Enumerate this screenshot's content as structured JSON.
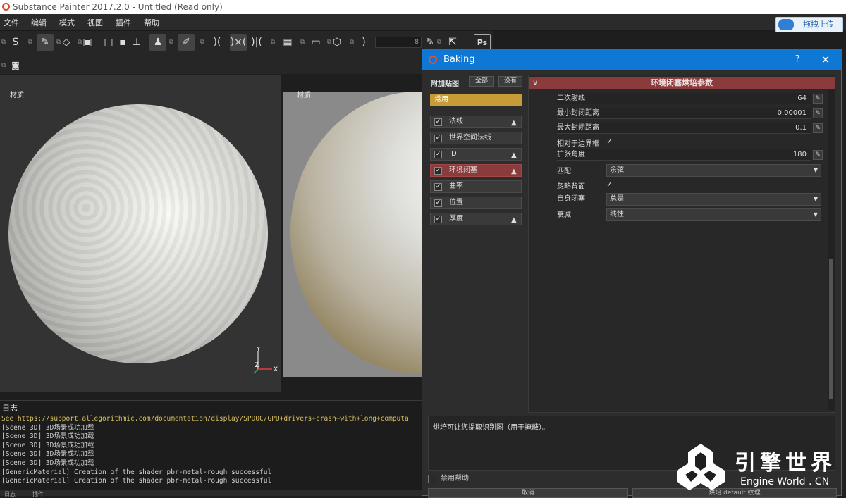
{
  "window": {
    "title": "Substance Painter 2017.2.0 - Untitled (Read only)"
  },
  "menu": [
    "文件",
    "编辑",
    "模式",
    "视图",
    "插件",
    "帮助"
  ],
  "upload_button": "拖拽上传",
  "toolbar": {
    "slider_value": "8"
  },
  "viewports": {
    "left_label": "材质",
    "right_label": "材质"
  },
  "axes": {
    "y": "Y",
    "z": "Z",
    "x": "X"
  },
  "log": {
    "title": "日志",
    "lines": [
      {
        "text": "    See https://support.allegorithmic.com/documentation/display/SPDOC/GPU+drivers+crash+with+long+computa",
        "warn": true
      },
      {
        "text": "[Scene 3D] 3D场景成功加载"
      },
      {
        "text": "[Scene 3D] 3D场景成功加载"
      },
      {
        "text": "[Scene 3D] 3D场景成功加载"
      },
      {
        "text": "[Scene 3D] 3D场景成功加载"
      },
      {
        "text": "[Scene 3D] 3D场景成功加载"
      },
      {
        "text": "[GenericMaterial] Creation of the shader pbr-metal-rough successful"
      },
      {
        "text": "[GenericMaterial] Creation of the shader pbr-metal-rough successful"
      }
    ],
    "tabs": [
      "日志",
      "插件"
    ]
  },
  "dialog": {
    "title": "Baking",
    "help": "?",
    "close": "✕",
    "maps_title": "附加贴图",
    "all_button": "全部",
    "none_button": "没有",
    "common": "常用",
    "maps": [
      {
        "label": "法线",
        "checked": true,
        "warning": true,
        "active": false
      },
      {
        "label": "世界空间法线",
        "checked": true,
        "warning": false,
        "active": false
      },
      {
        "label": "ID",
        "checked": true,
        "warning": true,
        "active": false
      },
      {
        "label": "环境闭塞",
        "checked": true,
        "warning": true,
        "active": true
      },
      {
        "label": "曲率",
        "checked": true,
        "warning": false,
        "active": false
      },
      {
        "label": "位置",
        "checked": true,
        "warning": false,
        "active": false
      },
      {
        "label": "厚度",
        "checked": true,
        "warning": true,
        "active": false
      }
    ],
    "section_title": "环境闭塞烘培参数",
    "params": {
      "secondary_rays": {
        "label": "二次射线",
        "value": "64"
      },
      "min_occluder": {
        "label": "最小封闭距离",
        "value": "0.00001"
      },
      "max_occluder": {
        "label": "最大封闭距离",
        "value": "0.1"
      },
      "relative_bbox": {
        "label": "相对于边界框",
        "checked": true
      },
      "spread_angle": {
        "label": "扩张角度",
        "value": "180"
      },
      "match": {
        "label": "匹配",
        "value": "余弦"
      },
      "ignore_backface": {
        "label": "忽略背面",
        "checked": true
      },
      "self_occlusion": {
        "label": "自身闭塞",
        "value": "总是"
      },
      "attenuation": {
        "label": "衰减",
        "value": "线性"
      }
    },
    "description": "烘培可让您提取识别图（用于掩蔽）。",
    "enable_help": "禁用帮助",
    "cancel_button": "取消",
    "bake_button": "烘培 default 纹理"
  },
  "watermark": {
    "cn": "引擎世界",
    "en": "Engine World . CN"
  }
}
